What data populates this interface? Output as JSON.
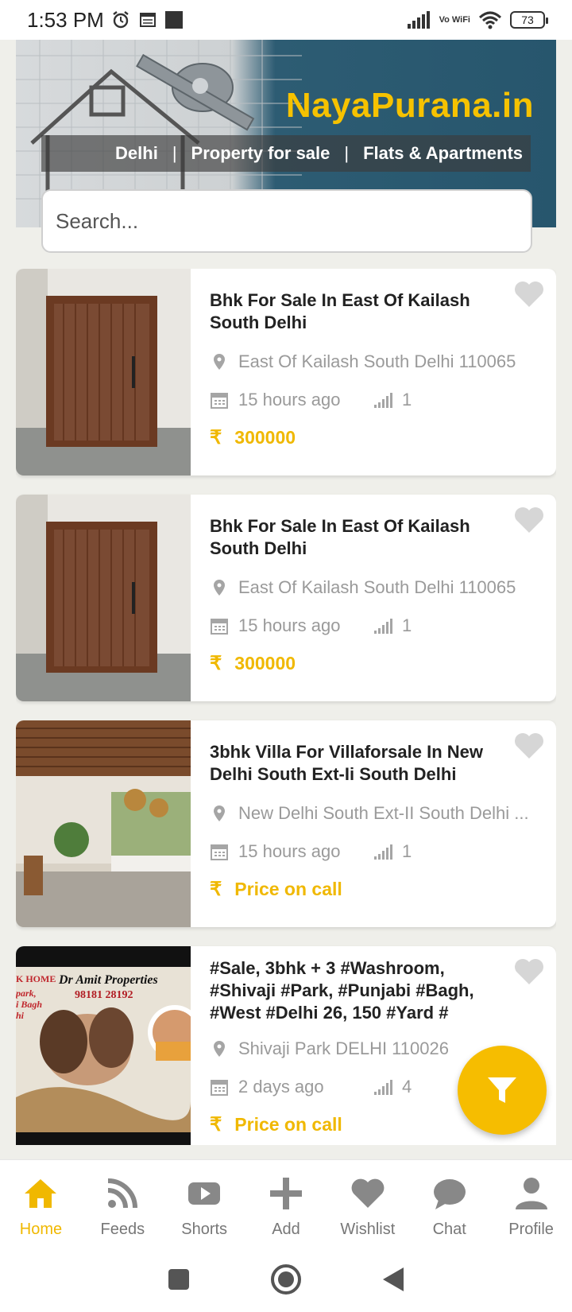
{
  "status_bar": {
    "time": "1:53 PM",
    "network": "Vo WiFi",
    "battery": "73"
  },
  "banner": {
    "brand": "NayaPurana.in",
    "crumbs": [
      "Delhi",
      "Property for sale",
      "Flats & Apartments"
    ],
    "separator": "|"
  },
  "search": {
    "placeholder": "Search..."
  },
  "listings": [
    {
      "title": "Bhk  For Sale In East Of Kailash South Delhi",
      "location": "East Of Kailash South Delhi 110065",
      "posted": "15 hours ago",
      "count": "1",
      "price": "300000"
    },
    {
      "title": "Bhk  For Sale In East Of Kailash South Delhi",
      "location": "East Of Kailash South Delhi 110065",
      "posted": "15 hours ago",
      "count": "1",
      "price": "300000"
    },
    {
      "title": "3bhk Villa For Villaforsale In New Delhi South Ext-Ii South Delhi",
      "location": "New Delhi South Ext-II South Delhi ...",
      "posted": "15 hours ago",
      "count": "1",
      "price": "Price on call"
    },
    {
      "title": "#Sale, 3bhk + 3 #Washroom, #Shivaji #Park, #Punjabi #Bagh, #West #Delhi 26, 150 #Yard #",
      "location": "Shivaji Park  DELHI 110026",
      "posted": "2 days ago",
      "count": "4",
      "price": "Price on call",
      "thumb_overlay": {
        "line1": "K HOME",
        "line2": "Dr Amit Properties",
        "phone": "98181 28192",
        "left_lines": [
          "park,",
          "i Bagh",
          "hi"
        ]
      }
    }
  ],
  "currency_symbol": "₹",
  "bottom_nav": [
    {
      "label": "Home",
      "icon": "home-icon",
      "active": true
    },
    {
      "label": "Feeds",
      "icon": "rss-icon"
    },
    {
      "label": "Shorts",
      "icon": "play-icon"
    },
    {
      "label": "Add",
      "icon": "plus-icon"
    },
    {
      "label": "Wishlist",
      "icon": "heart-icon"
    },
    {
      "label": "Chat",
      "icon": "chat-bubble-icon"
    },
    {
      "label": "Profile",
      "icon": "person-icon"
    }
  ],
  "colors": {
    "accent": "#f6bd00",
    "price": "#f0b800",
    "muted": "#9a9a9a",
    "banner_blue": "#27566d"
  }
}
